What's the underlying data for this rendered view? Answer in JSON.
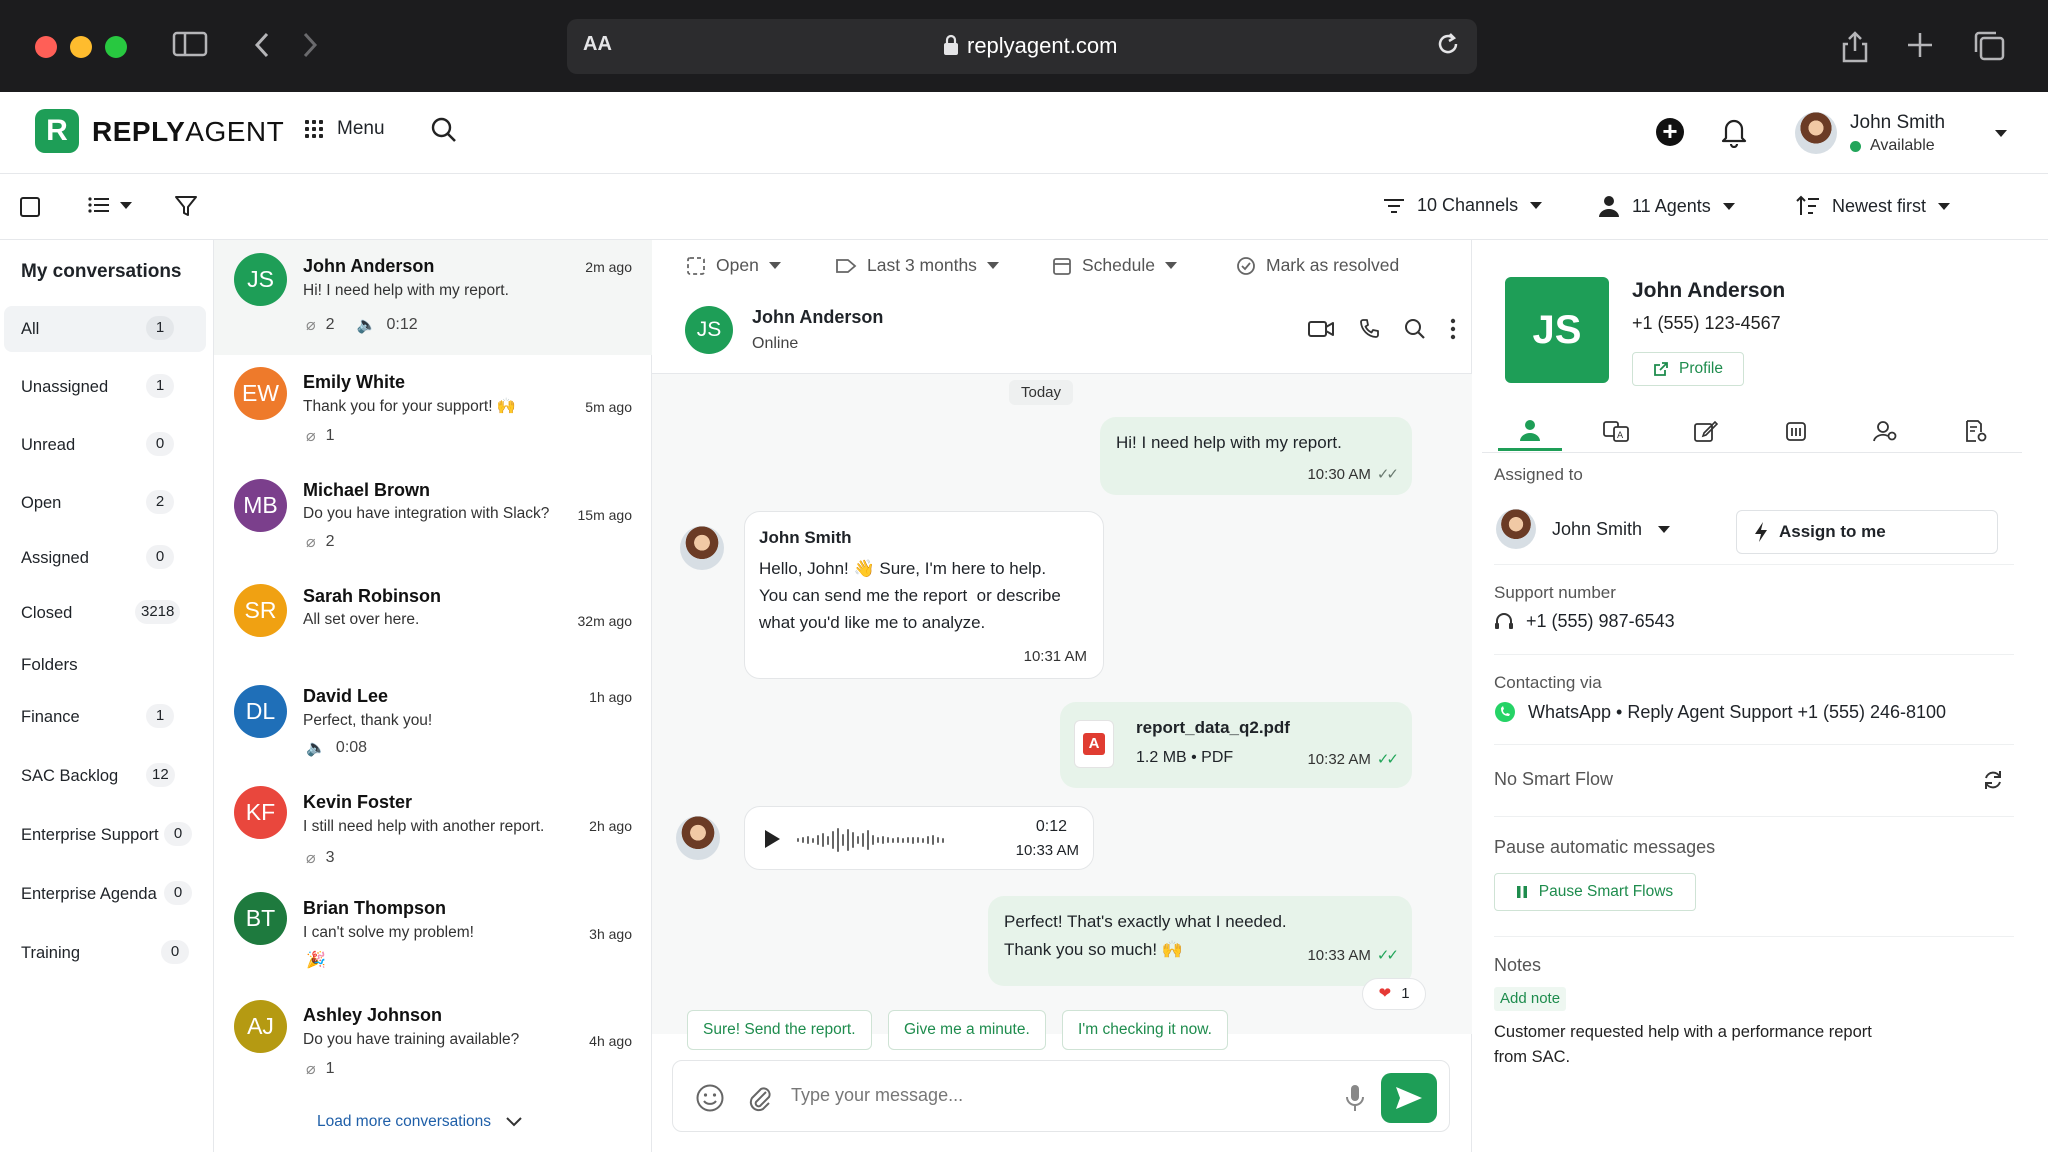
{
  "browser": {
    "aa_label": "AA",
    "url": "replyagent.com"
  },
  "header": {
    "logo_mark": "R",
    "logo_bold": "REPLY",
    "logo_light": "AGENT",
    "menu_label": "Menu",
    "user_name": "John Smith",
    "user_status": "Available"
  },
  "toolbar": {
    "channels": "10 Channels",
    "agents": "11 Agents",
    "sort": "Newest first"
  },
  "sidebar": {
    "title": "My conversations",
    "items": [
      {
        "label": "All",
        "count": "1"
      },
      {
        "label": "Unassigned",
        "count": "1"
      },
      {
        "label": "Unread",
        "count": "0"
      },
      {
        "label": "Open",
        "count": "2"
      },
      {
        "label": "Assigned",
        "count": "0"
      },
      {
        "label": "Closed",
        "count": "3218"
      }
    ],
    "folders_title": "Folders",
    "folders": [
      {
        "label": "Finance",
        "count": "1"
      },
      {
        "label": "SAC Backlog",
        "count": "12"
      },
      {
        "label": "Enterprise Support",
        "count": "0"
      },
      {
        "label": "Enterprise Agenda",
        "count": "0"
      },
      {
        "label": "Training",
        "count": "0"
      }
    ]
  },
  "conversations": [
    {
      "initials": "JS",
      "name": "John Anderson",
      "preview": "Hi! I need help with my report.",
      "time": "2m ago",
      "attachments": "2",
      "audio": "0:12",
      "color": "#1e9e57"
    },
    {
      "initials": "EW",
      "name": "Emily White",
      "preview": "Thank you for your support! 🙌",
      "time": "5m ago",
      "attachments": "1",
      "color": "#ee7a2b"
    },
    {
      "initials": "MB",
      "name": "Michael Brown",
      "preview": "Do you have integration with Slack?",
      "time": "15m ago",
      "attachments": "2",
      "color": "#7b3f8c"
    },
    {
      "initials": "SR",
      "name": "Sarah Robinson",
      "preview": "All set over here.",
      "time": "32m ago",
      "color": "#f0a112"
    },
    {
      "initials": "DL",
      "name": "David Lee",
      "preview": "Perfect, thank you!",
      "time": "1h ago",
      "audio": "0:08",
      "color": "#1f6fb8"
    },
    {
      "initials": "KF",
      "name": "Kevin Foster",
      "preview": "I still need help with another report.",
      "time": "2h ago",
      "attachments": "3",
      "color": "#e9473d"
    },
    {
      "initials": "BT",
      "name": "Brian Thompson",
      "preview": "I can't solve my problem!",
      "time": "3h ago",
      "emoji": "🎉",
      "color": "#1e7a3e"
    },
    {
      "initials": "AJ",
      "name": "Ashley Johnson",
      "preview": "Do you have training available?",
      "time": "4h ago",
      "attachments": "1",
      "color": "#b59a12"
    }
  ],
  "load_more": "Load more conversations",
  "chat": {
    "filters": {
      "status": "Open",
      "range": "Last 3 months",
      "schedule": "Schedule",
      "resolve": "Mark as resolved"
    },
    "contact_initials": "JS",
    "contact_name": "John Anderson",
    "contact_status": "Online",
    "day": "Today",
    "messages": {
      "m1_text": "Hi! I need help with my report.",
      "m1_time": "10:30 AM",
      "m2_sender": "John Smith",
      "m2_line1": "Hello, John! 👋 Sure, I'm here to help.",
      "m2_line2": "You can send me the report  or describe",
      "m2_line3": "what you'd like me to analyze.",
      "m2_time": "10:31 AM",
      "file_name": "report_data_q2.pdf",
      "file_meta": "1.2 MB • PDF",
      "file_icon": "A",
      "file_time": "10:32 AM",
      "audio_duration": "0:12",
      "audio_time": "10:33 AM",
      "m5_line1": "Perfect! That's exactly what I needed.",
      "m5_line2": "Thank you so much! 🙌",
      "m5_time": "10:33 AM",
      "reaction_count": "1"
    },
    "quick_replies": [
      "Sure! Send the report.",
      "Give me a minute.",
      "I'm checking it now."
    ],
    "composer_placeholder": "Type your message..."
  },
  "contact": {
    "initials": "JS",
    "name": "John Anderson",
    "phone": "+1 (555) 123-4567",
    "profile_label": "Profile",
    "assigned_label": "Assigned to",
    "assignee": "John Smith",
    "assign_me": "Assign to me",
    "support_label": "Support number",
    "support_number": "+1 (555) 987-6543",
    "contacting_label": "Contacting via",
    "contacting_value": "WhatsApp • Reply Agent Support +1 (555) 246-8100",
    "smart_flow": "No Smart Flow",
    "pause_label": "Pause automatic messages",
    "pause_button": "Pause Smart Flows",
    "notes_label": "Notes",
    "add_note": "Add note",
    "note_text": "Customer requested help with a performance report from SAC."
  },
  "colors": {
    "brand_green": "#1e9e57",
    "chrome": "#1c1c1e"
  }
}
